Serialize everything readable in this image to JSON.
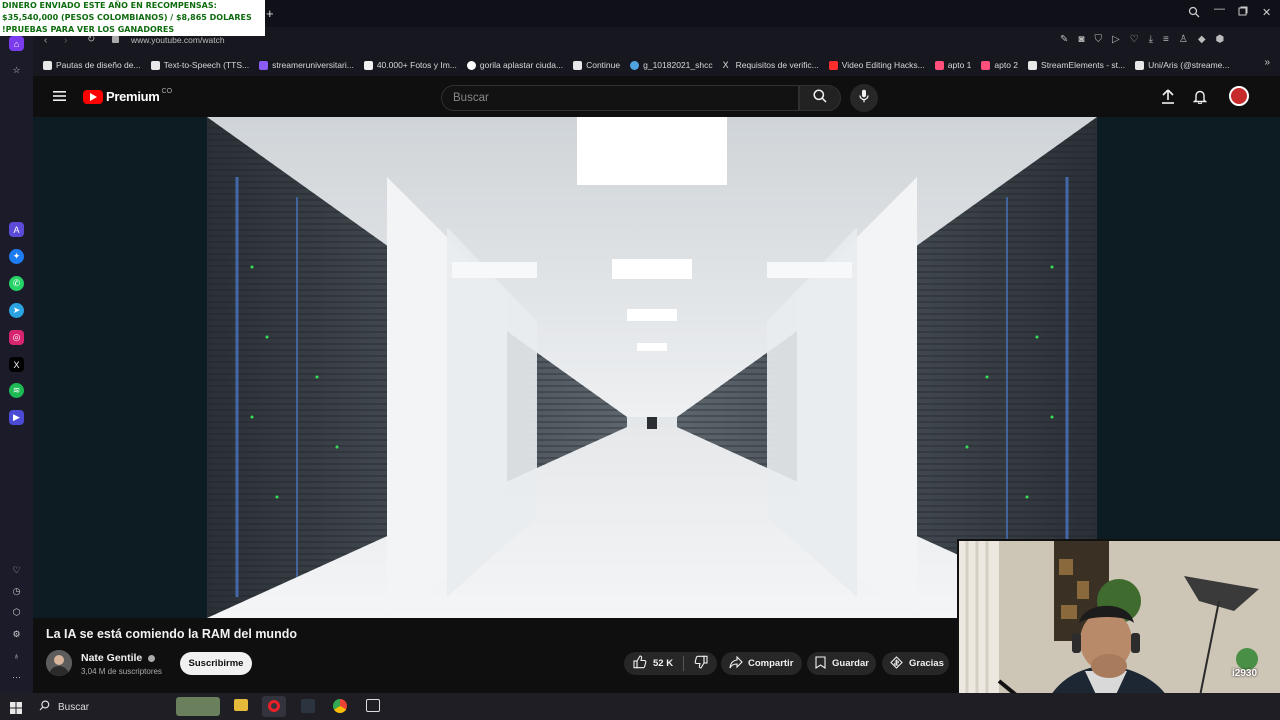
{
  "overlay_banner": {
    "line1": "DINERO ENVIADO ESTE AÑO EN RECOMPENSAS:",
    "line2": " $35,540,000 (PESOS COLOMBIANOS) / $8,865 DOLARES",
    "line3": "!PRUEBAS PARA VER LOS GANADORES"
  },
  "browser": {
    "new_tab": "+",
    "url": "www.youtube.com/watch",
    "bookmarks": [
      {
        "label": "Pautas de diseño de...",
        "icon_color": "#e8e8e8"
      },
      {
        "label": "Text-to-Speech (TTS...",
        "icon_color": "#e8e8e8"
      },
      {
        "label": "streameruniversitari...",
        "icon_color": "#8a5cf5"
      },
      {
        "label": "40.000+ Fotos y Im...",
        "icon_color": "#f1f1f1"
      },
      {
        "label": "gorila aplastar ciuda...",
        "icon_color": "#ffffff"
      },
      {
        "label": "Continue",
        "icon_color": "#e8e8e8"
      },
      {
        "label": "g_10182021_shcc",
        "icon_color": "#4fa3e0"
      },
      {
        "label": "Requisitos de verific...",
        "icon_color": "#dddddd"
      },
      {
        "label": "Video Editing Hacks...",
        "icon_color": "#ff2d2d"
      },
      {
        "label": "apto 1",
        "icon_color": "#ff4f7a"
      },
      {
        "label": "apto 2",
        "icon_color": "#ff4f7a"
      },
      {
        "label": "StreamElements - st...",
        "icon_color": "#e8e8e8"
      },
      {
        "label": "Uni/Aris (@streame...",
        "icon_color": "#e8e8e8"
      }
    ],
    "more": "»"
  },
  "youtube": {
    "logo_text": "Premium",
    "country": "CO",
    "search_placeholder": "Buscar",
    "video_title": "La IA se está comiendo la RAM del mundo",
    "channel_name": "Nate Gentile",
    "subscribers": "3,04 M de suscriptores",
    "subscribe_label": "Suscribirme",
    "likes": "52 K",
    "share_label": "Compartir",
    "save_label": "Guardar",
    "thanks_label": "Gracias"
  },
  "webcam": {
    "badge_text": "i2930"
  },
  "taskbar": {
    "search_label": "Buscar"
  },
  "colors": {
    "youtube_red": "#ff0000",
    "banner_text": "#0e6b0e",
    "background": "#0f0f0f"
  }
}
